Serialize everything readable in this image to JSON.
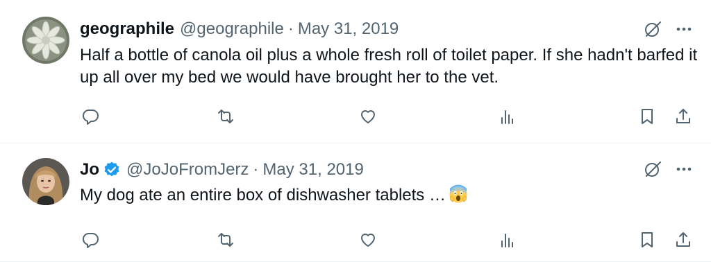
{
  "tweets": [
    {
      "display_name": "geographile",
      "verified": false,
      "handle": "@geographile",
      "separator": "·",
      "date": "May 31, 2019",
      "text": "Half a bottle of canola oil plus a whole fresh roll of toilet paper. If she hadn't barfed it up all over my bed we would have brought her to the vet.",
      "emoji": ""
    },
    {
      "display_name": "Jo",
      "verified": true,
      "handle": "@JoJoFromJerz",
      "separator": "·",
      "date": "May 31, 2019",
      "text": "My dog ate an entire box of dishwasher tablets …",
      "emoji": "screaming-face-emoji"
    }
  ],
  "icons": {
    "reply": "reply-icon",
    "retweet": "retweet-icon",
    "like": "heart-icon",
    "views": "views-icon",
    "bookmark": "bookmark-icon",
    "share": "share-icon",
    "grok": "grok-icon",
    "more": "more-icon"
  },
  "colors": {
    "text_primary": "#0f1419",
    "text_secondary": "#536471",
    "verified_blue": "#1d9bf0",
    "divider": "#eff3f4"
  }
}
